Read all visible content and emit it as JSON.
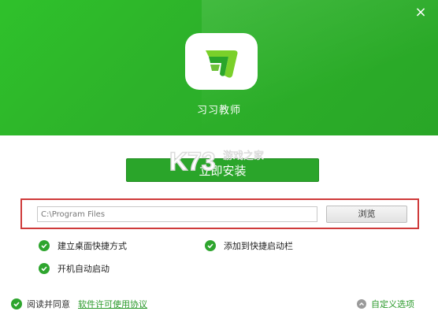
{
  "app": {
    "name": "习习教师"
  },
  "install": {
    "button_label": "立即安装"
  },
  "watermark": {
    "brand": "K73",
    "text": "游戏之家"
  },
  "install_path": {
    "value": "C:\\Program Files",
    "browse_label": "浏览"
  },
  "options": [
    {
      "label": "建立桌面快捷方式",
      "checked": true
    },
    {
      "label": "添加到快捷启动栏",
      "checked": true
    },
    {
      "label": "开机自动启动",
      "checked": true
    }
  ],
  "footer": {
    "agree_text": "阅读并同意",
    "license_link": "软件许可使用协议",
    "custom_options": "自定义选项"
  },
  "colors": {
    "brand_green": "#2db22a",
    "highlight_red": "#cf3a3a"
  }
}
